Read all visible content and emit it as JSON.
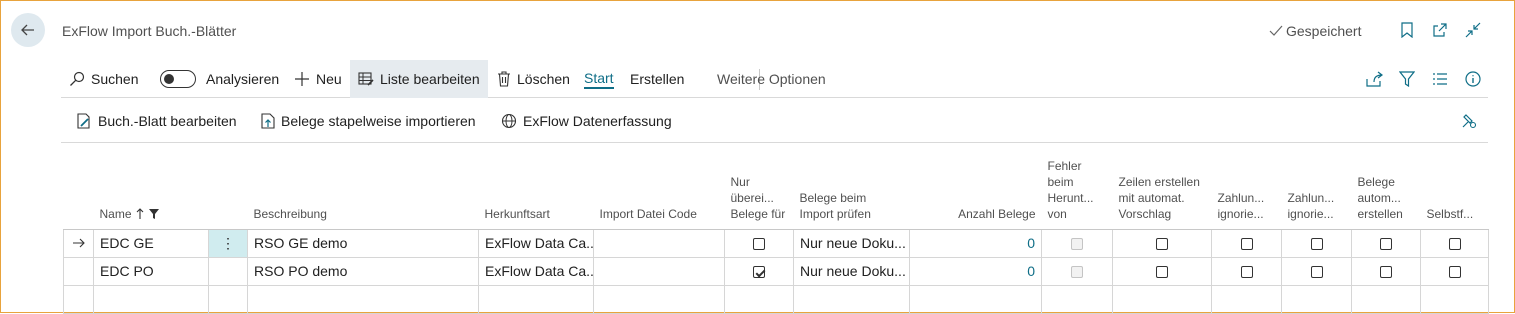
{
  "title": "ExFlow Import Buch.-Blätter",
  "saved_status": "Gespeichert",
  "actions": {
    "search": "Suchen",
    "analyze": "Analysieren",
    "new": "Neu",
    "edit_list": "Liste bearbeiten",
    "delete": "Löschen",
    "start": "Start",
    "create": "Erstellen",
    "more": "Weitere Optionen"
  },
  "subactions": {
    "edit_journal": "Buch.-Blatt bearbeiten",
    "batch_import": "Belege stapelweise importieren",
    "data_capture": "ExFlow Datenerfassung"
  },
  "columns": {
    "name": "Name",
    "description": "Beschreibung",
    "source_type": "Herkunftsart",
    "import_file_code": "Import Datei Code",
    "skip_docs": "Nur überei... Belege für",
    "check_on_import": "Belege beim Import prüfen",
    "doc_count": "Anzahl Belege",
    "error_download": "Fehler beim Herunt... von",
    "create_lines": "Zeilen erstellen mit automat. Vorschlag",
    "payment_ignore1": "Zahlun... ignorie...",
    "payment_ignore2": "Zahlun... ignorie...",
    "auto_create": "Belege autom... erstellen",
    "self": "Selbstf..."
  },
  "rows": [
    {
      "name": "EDC GE",
      "description": "RSO GE demo",
      "source_type": "ExFlow Data Ca...",
      "import_file_code": "",
      "skip_docs": false,
      "check_on_import": "Nur neue Doku...",
      "doc_count": "0",
      "error_download": false,
      "create_lines": false,
      "payment_ignore1": false,
      "payment_ignore2": false,
      "auto_create": false,
      "self": false
    },
    {
      "name": "EDC PO",
      "description": "RSO PO demo",
      "source_type": "ExFlow Data Ca...",
      "import_file_code": "",
      "skip_docs": true,
      "check_on_import": "Nur neue Doku...",
      "doc_count": "0",
      "error_download": false,
      "create_lines": false,
      "payment_ignore1": false,
      "payment_ignore2": false,
      "auto_create": false,
      "self": false
    }
  ],
  "colors": {
    "accent": "#0f6e87",
    "frame": "#e8a33d",
    "selected_cell": "#d0ecef"
  }
}
